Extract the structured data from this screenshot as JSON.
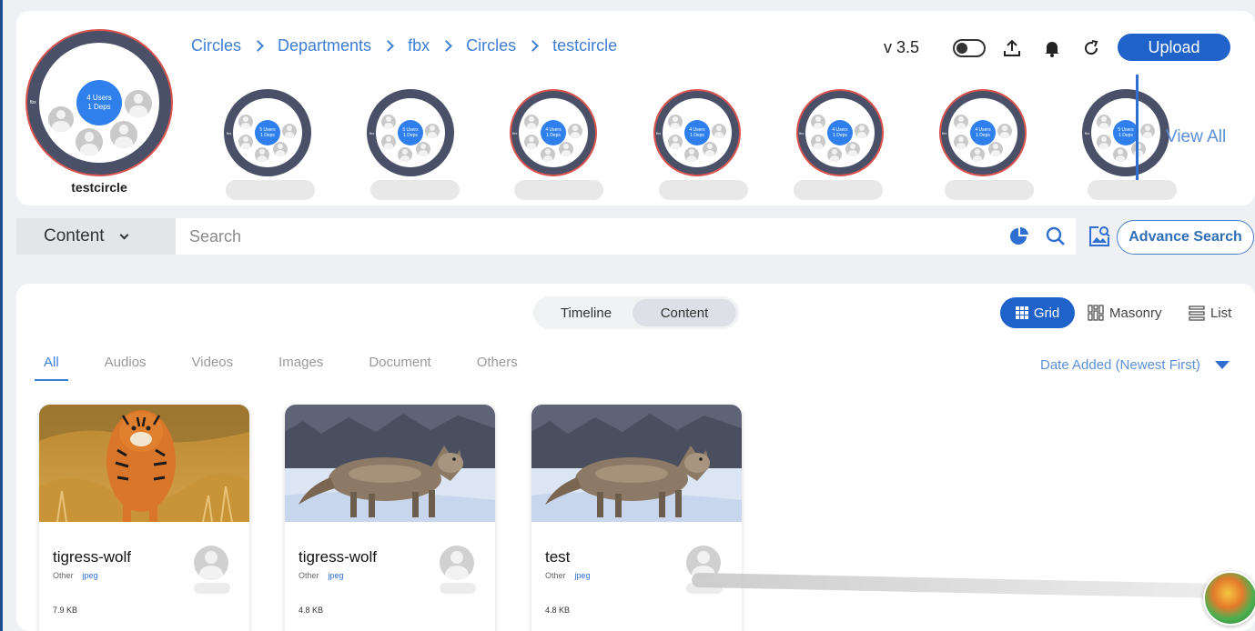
{
  "header": {
    "breadcrumb": [
      "Circles",
      "Departments",
      "fbx",
      "Circles",
      "testcircle"
    ],
    "version": "v 3.5",
    "upload_label": "Upload",
    "icons": [
      "theme-toggle-icon",
      "share-upload-icon",
      "bell-icon",
      "refresh-icon"
    ]
  },
  "main_circle": {
    "name": "testcircle",
    "users": "4 Users",
    "deps": "1 Deps",
    "tag": "fbx"
  },
  "sub_circles": [
    {
      "users": "5 Users",
      "deps": "1 Deps",
      "tag": "fbx",
      "highlight": false
    },
    {
      "users": "5 Users",
      "deps": "1 Deps",
      "tag": "fbx",
      "highlight": false
    },
    {
      "users": "4 Users",
      "deps": "1 Deps",
      "tag": "fbx",
      "highlight": true
    },
    {
      "users": "4 Users",
      "deps": "1 Deps",
      "tag": "fbx",
      "highlight": true
    },
    {
      "users": "4 Users",
      "deps": "1 Deps",
      "tag": "fbx",
      "highlight": true
    },
    {
      "users": "4 Users",
      "deps": "1 Deps",
      "tag": "fbx",
      "highlight": true
    },
    {
      "users": "5 Users",
      "deps": "1 Deps",
      "tag": "fbx",
      "highlight": false
    }
  ],
  "view_all_label": "View All",
  "search": {
    "scope": "Content",
    "placeholder": "Search",
    "advance_label": "Advance Search"
  },
  "toggle": {
    "timeline": "Timeline",
    "content": "Content",
    "active": "Content"
  },
  "views": {
    "grid": "Grid",
    "masonry": "Masonry",
    "list": "List",
    "active": "Grid"
  },
  "tabs": [
    "All",
    "Audios",
    "Videos",
    "Images",
    "Document",
    "Others"
  ],
  "active_tab": "All",
  "sort_label": "Date Added (Newest First)",
  "cards": [
    {
      "title": "tigress-wolf",
      "type": "Other",
      "ext": "jpeg",
      "size": "7.9 KB",
      "image": "tiger"
    },
    {
      "title": "tigress-wolf",
      "type": "Other",
      "ext": "jpeg",
      "size": "4.8 KB",
      "image": "wolf"
    },
    {
      "title": "test",
      "type": "Other",
      "ext": "jpeg",
      "size": "4.8 KB",
      "image": "wolf"
    }
  ],
  "colors": {
    "accent": "#1f62c9",
    "link": "#3d7fd6",
    "ring": "#4a5068",
    "ring_highlight": "#d9534f",
    "hub": "#2f80ed"
  }
}
